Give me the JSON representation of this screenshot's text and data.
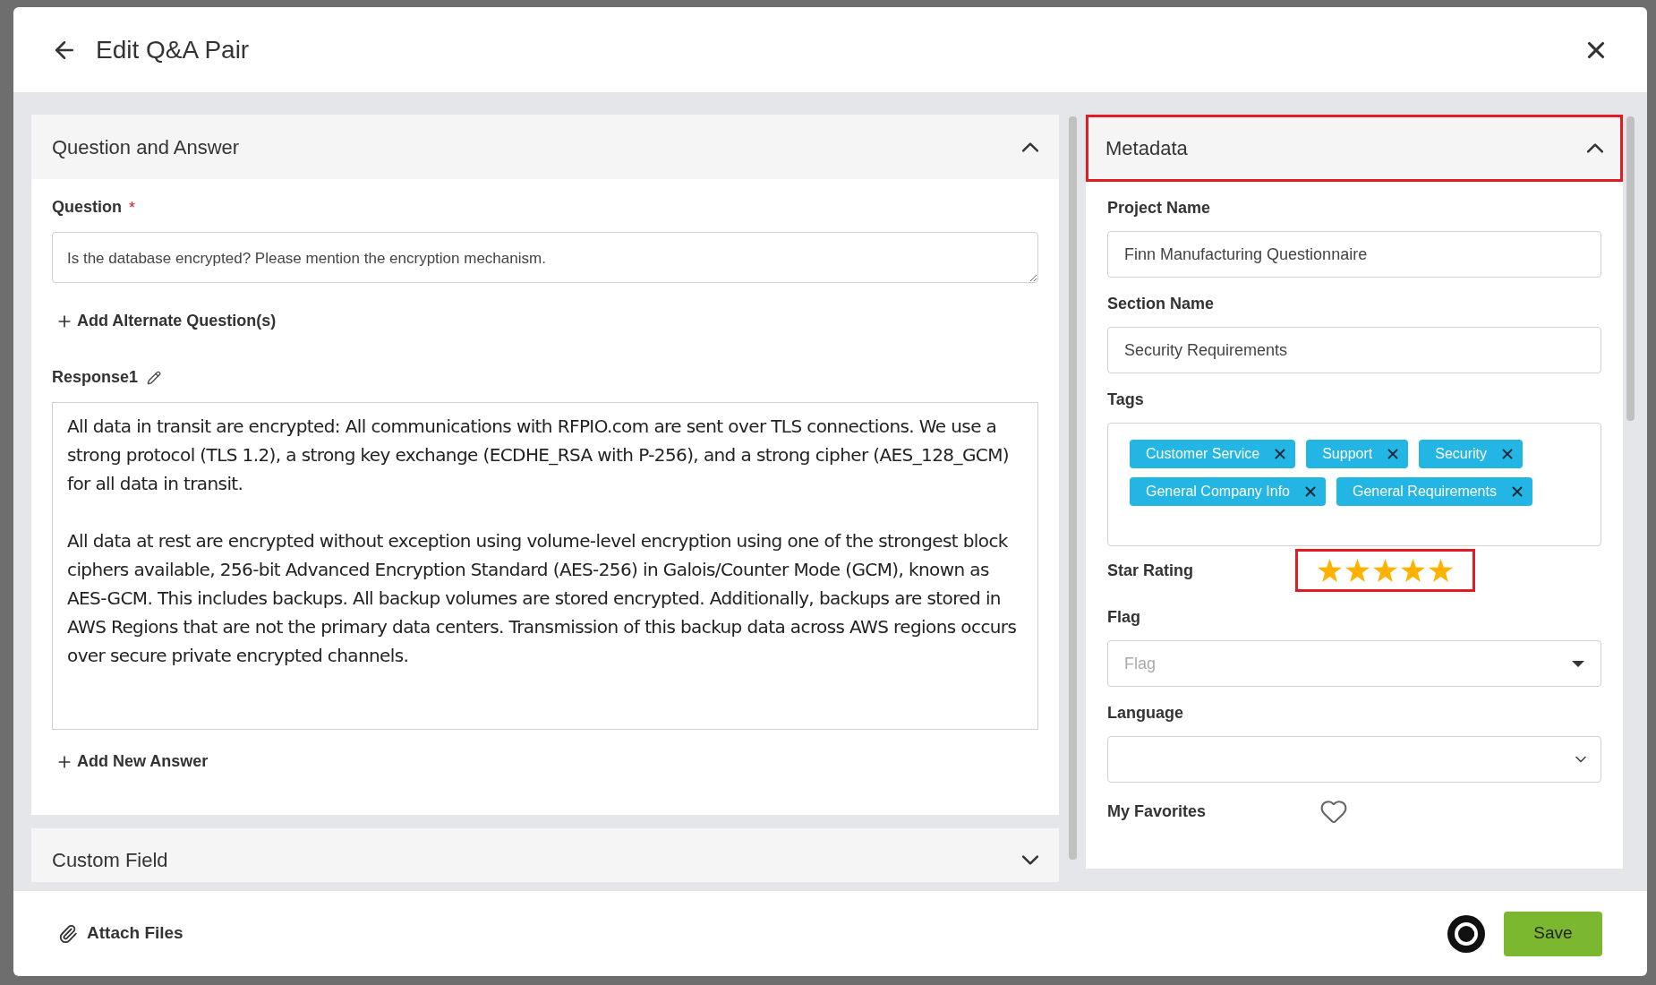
{
  "dialog": {
    "title": "Edit Q&A Pair"
  },
  "qa_section": {
    "title": "Question and Answer",
    "expanded": true,
    "question": {
      "label": "Question",
      "required": true,
      "required_mark": "*",
      "value": "Is the database encrypted? Please mention the encryption mechanism."
    },
    "add_alternate": "Add Alternate Question(s)",
    "responses": [
      {
        "label": "Response1",
        "paragraphs": [
          "All data in transit are encrypted:  All communications with RFPIO.com are sent over TLS connections.  We use a strong protocol (TLS 1.2), a strong key exchange (ECDHE_RSA with P-256), and a strong cipher (AES_128_GCM) for all data in transit.",
          "All data at rest are encrypted without exception using volume-level encryption using one of the strongest block ciphers available, 256-bit Advanced Encryption Standard (AES-256) in Galois/Counter Mode (GCM), known as AES-GCM.  This includes backups.  All backup volumes are stored encrypted.  Additionally, backups are stored in AWS Regions that are not the primary data centers.  Transmission of this backup data across AWS regions occurs over secure private encrypted channels."
        ]
      }
    ],
    "add_answer": "Add New Answer"
  },
  "custom_field_section": {
    "title": "Custom Field",
    "expanded": false
  },
  "metadata": {
    "title": "Metadata",
    "expanded": true,
    "highlighted": true,
    "fields": [
      {
        "kind": "text",
        "label": "Project Name",
        "value": "Finn Manufacturing Questionnaire"
      },
      {
        "kind": "text",
        "label": "Section Name",
        "value": "Security Requirements"
      },
      {
        "kind": "tags",
        "label": "Tags",
        "tags": [
          "Customer Service",
          "Support",
          "Security",
          "General Company Info",
          "General Requirements"
        ]
      },
      {
        "kind": "stars",
        "label": "Star Rating",
        "stars": 5,
        "highlighted": true
      },
      {
        "kind": "select",
        "label": "Flag",
        "placeholder": "Flag"
      },
      {
        "kind": "dropdown",
        "label": "Language"
      },
      {
        "kind": "favorite",
        "label": "My Favorites",
        "on": false
      }
    ]
  },
  "footer": {
    "attach": "Attach Files",
    "save": "Save"
  }
}
